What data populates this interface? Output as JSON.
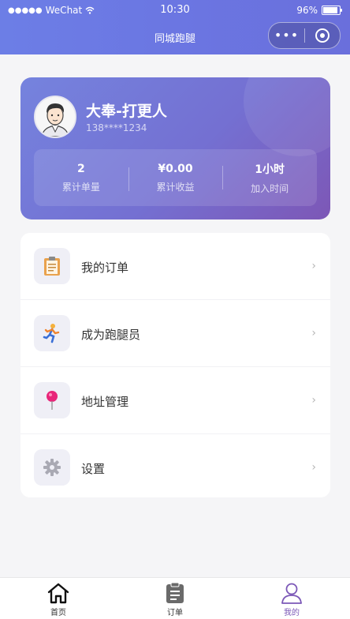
{
  "status_bar": {
    "carrier": "WeChat",
    "time": "10:30",
    "battery": "96%"
  },
  "nav": {
    "title": "同城跑腿",
    "more_glyph": "•••"
  },
  "profile": {
    "name": "大奉-打更人",
    "phone": "138****1234",
    "stats": [
      {
        "value": "2",
        "label": "累计单量"
      },
      {
        "value": "¥0.00",
        "label": "累计收益"
      },
      {
        "value": "1小时",
        "label": "加入时间"
      }
    ]
  },
  "menu": {
    "items": [
      {
        "label": "我的订单",
        "icon": "clipboard-icon"
      },
      {
        "label": "成为跑腿员",
        "icon": "runner-icon"
      },
      {
        "label": "地址管理",
        "icon": "location-pin-icon"
      },
      {
        "label": "设置",
        "icon": "gear-icon"
      }
    ],
    "arrow": "›"
  },
  "tabbar": {
    "tabs": [
      {
        "label": "首页",
        "icon": "home-icon"
      },
      {
        "label": "订单",
        "icon": "order-icon"
      },
      {
        "label": "我的",
        "icon": "person-icon",
        "active": true
      }
    ]
  },
  "colors": {
    "accent": "#6c78e4",
    "card_gradient_end": "#7d57b6",
    "active_tab": "#7b57b7"
  }
}
